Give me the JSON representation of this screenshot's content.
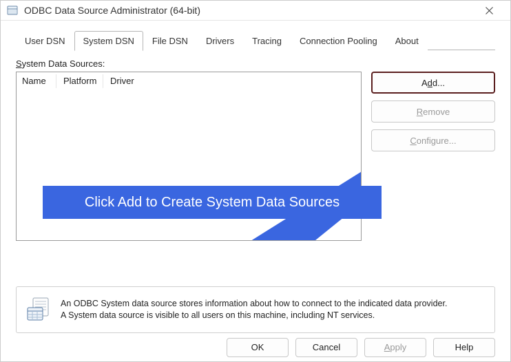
{
  "window": {
    "title": "ODBC Data Source Administrator (64-bit)"
  },
  "tabs": [
    {
      "label": "User DSN"
    },
    {
      "label": "System DSN"
    },
    {
      "label": "File DSN"
    },
    {
      "label": "Drivers"
    },
    {
      "label": "Tracing"
    },
    {
      "label": "Connection Pooling"
    },
    {
      "label": "About"
    }
  ],
  "section": {
    "label_prefix": "S",
    "label_rest": "ystem Data Sources:"
  },
  "columns": {
    "name": "Name",
    "platform": "Platform",
    "driver": "Driver"
  },
  "buttons": {
    "add_prefix": "A",
    "add_mid": "d",
    "add_suffix": "d...",
    "remove_prefix": "",
    "remove_mid": "R",
    "remove_suffix": "emove",
    "configure_prefix": "",
    "configure_mid": "C",
    "configure_suffix": "onfigure...",
    "ok": "OK",
    "cancel": "Cancel",
    "apply_prefix": "",
    "apply_mid": "A",
    "apply_suffix": "pply",
    "help": "Help"
  },
  "info": {
    "line1": "An ODBC System data source stores information about how to connect to the indicated data provider.",
    "line2": "A System data source is visible to all users on this machine, including NT services."
  },
  "callout": {
    "text": "Click Add to Create System Data Sources"
  }
}
